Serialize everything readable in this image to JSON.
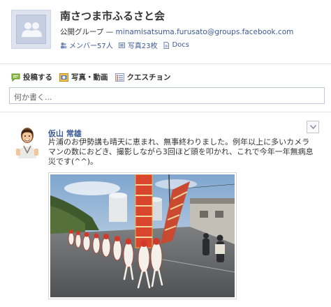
{
  "group": {
    "title": "南さつま市ふるさと会",
    "type_label": "公開グループ — ",
    "email": "minamisatsuma.furusato@groups.facebook.com",
    "stats": {
      "members": "メンバー57人",
      "photos": "写真23枚",
      "docs": "Docs"
    }
  },
  "composer": {
    "tabs": [
      "投稿する",
      "写真・動画",
      "クエスチョン"
    ],
    "placeholder": "何か書く..."
  },
  "post": {
    "author": "仮山 常雄",
    "text": "片浦のお伊勢講も晴天に恵まれ、無事終わりました。例年以上に多いカメラマンの数におどき、撮影しながら3回ほど頭を叩かれ、これで今年一年無病息災です(^^)。"
  },
  "colors": {
    "link": "#3b5998",
    "border": "#bdc7d8"
  }
}
